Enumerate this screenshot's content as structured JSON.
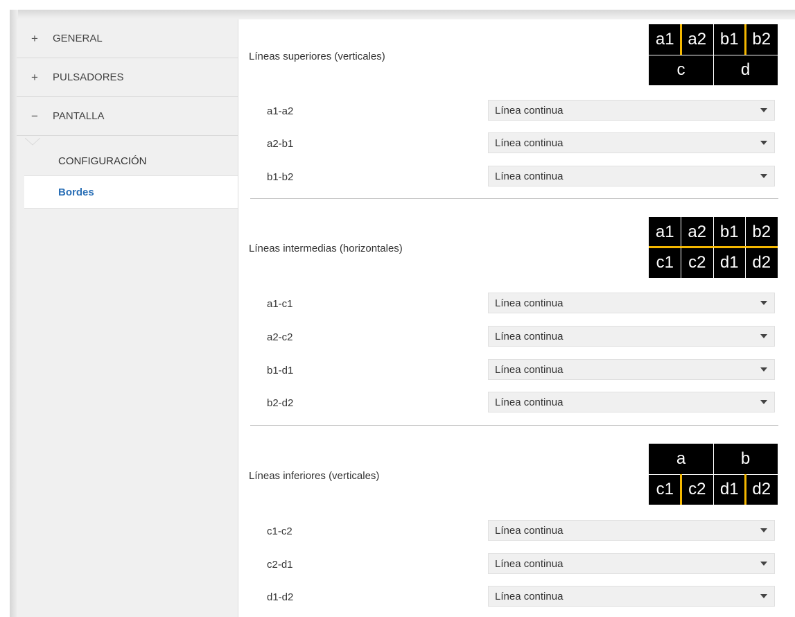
{
  "sidebar": {
    "items": [
      {
        "sign": "+",
        "label": "GENERAL"
      },
      {
        "sign": "+",
        "label": "PULSADORES"
      },
      {
        "sign": "−",
        "label": "PANTALLA"
      }
    ],
    "sub_items": [
      {
        "label": "CONFIGURACIÓN"
      },
      {
        "label": "Bordes"
      }
    ]
  },
  "sections": [
    {
      "title": "Líneas superiores (verticales)",
      "diagram": {
        "top": [
          "a1",
          "a2",
          "b1",
          "b2"
        ],
        "bottom": [
          "c",
          "d"
        ]
      },
      "rows": [
        {
          "label": "a1-a2",
          "value": "Línea continua"
        },
        {
          "label": "a2-b1",
          "value": "Línea continua"
        },
        {
          "label": "b1-b2",
          "value": "Línea continua"
        }
      ]
    },
    {
      "title": "Líneas intermedias (horizontales)",
      "diagram": {
        "top": [
          "a1",
          "a2",
          "b1",
          "b2"
        ],
        "bottom": [
          "c1",
          "c2",
          "d1",
          "d2"
        ]
      },
      "rows": [
        {
          "label": "a1-c1",
          "value": "Línea continua"
        },
        {
          "label": "a2-c2",
          "value": "Línea continua"
        },
        {
          "label": "b1-d1",
          "value": "Línea continua"
        },
        {
          "label": "b2-d2",
          "value": "Línea continua"
        }
      ]
    },
    {
      "title": "Líneas inferiores (verticales)",
      "diagram": {
        "top": [
          "a",
          "b"
        ],
        "bottom": [
          "c1",
          "c2",
          "d1",
          "d2"
        ]
      },
      "rows": [
        {
          "label": "c1-c2",
          "value": "Línea continua"
        },
        {
          "label": "c2-d1",
          "value": "Línea continua"
        },
        {
          "label": "d1-d2",
          "value": "Línea continua"
        }
      ]
    }
  ],
  "colors": {
    "accent_line": "#f5b800",
    "active_link": "#2a6fb6",
    "diagram_bg": "#000000"
  }
}
